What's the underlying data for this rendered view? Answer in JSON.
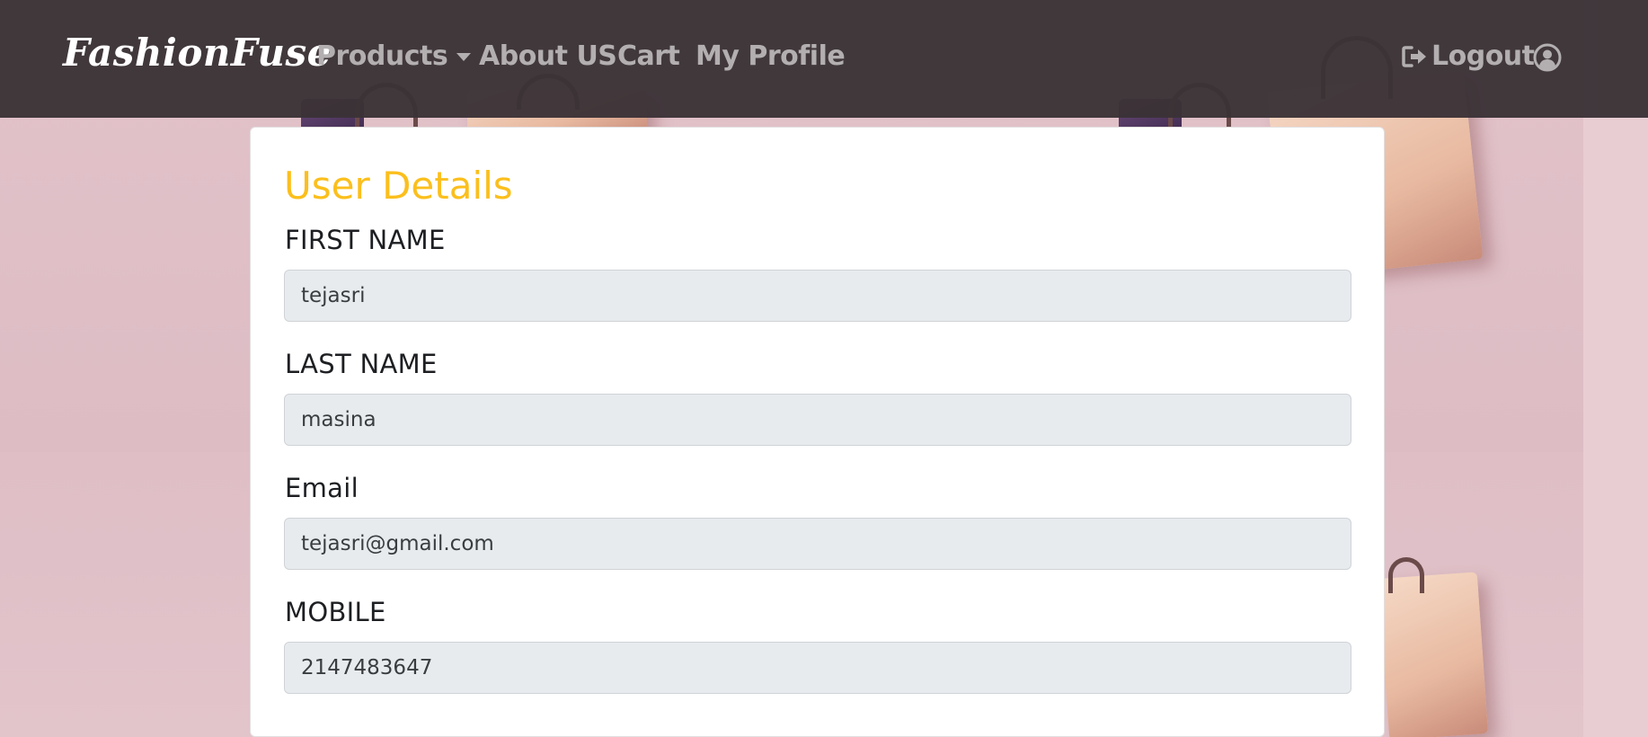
{
  "navbar": {
    "brand": "FashionFuse",
    "products_label": "Products",
    "about_label": "About US",
    "cart_label": "Cart",
    "profile_label": "My Profile",
    "logout_label": "Logout",
    "logout_icon": "sign-out-icon",
    "user_icon": "user-circle-icon"
  },
  "card": {
    "title": "User Details",
    "fields": [
      {
        "label": "FIRST NAME",
        "value": "tejasri"
      },
      {
        "label": "LAST NAME",
        "value": "masina"
      },
      {
        "label": "Email",
        "value": "tejasri@gmail.com"
      },
      {
        "label": "MOBILE",
        "value": "2147483647"
      }
    ]
  },
  "colors": {
    "navbar_bg": "#3a3236",
    "nav_text": "#b3afb1",
    "title_accent": "#fbbf1d",
    "input_bg": "#e8ebee",
    "page_bg": "#e6c9cf"
  }
}
